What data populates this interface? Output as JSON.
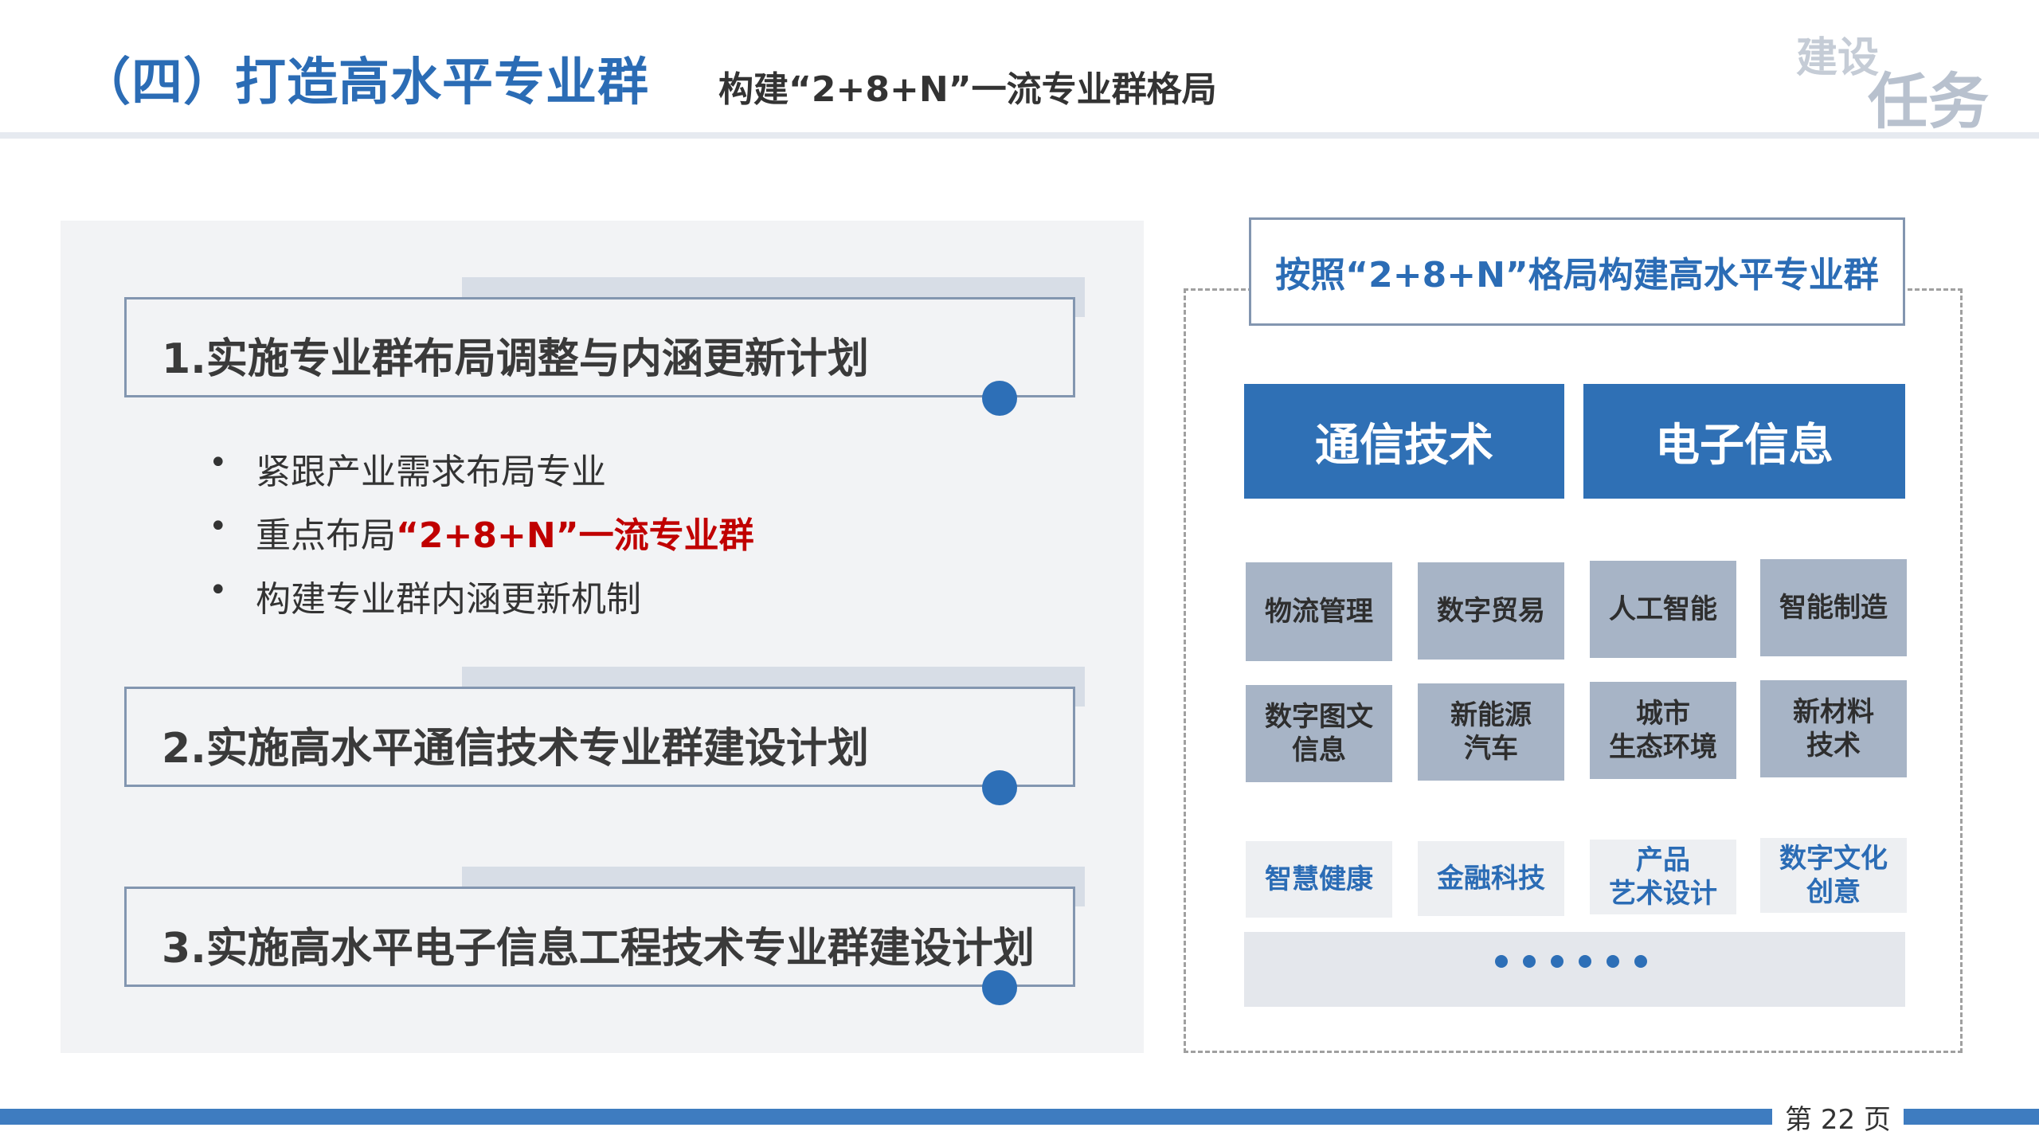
{
  "header": {
    "title": "（四）打造高水平专业群",
    "subtitle": "构建“2+8+N”一流专业群格局",
    "corner_word_1": "建设",
    "corner_word_2": "任务"
  },
  "plans": [
    {
      "label": "1.实施专业群布局调整与内涵更新计划"
    },
    {
      "label": "2.实施高水平通信技术专业群建设计划"
    },
    {
      "label": "3.实施高水平电子信息工程技术专业群建设计划"
    }
  ],
  "bullets": [
    {
      "text": "紧跟产业需求布局专业",
      "strong": ""
    },
    {
      "text": "重点布局",
      "strong": "“2+8+N”一流专业群"
    },
    {
      "text": "构建专业群内涵更新机制",
      "strong": ""
    }
  ],
  "bullet_symbol": "•",
  "diagram": {
    "header": "按照“2+8+N”格局构建高水平专业群",
    "main_groups": [
      "通信技术",
      "电子信息"
    ],
    "professional_groups": [
      {
        "line1": "物流管理",
        "line2": ""
      },
      {
        "line1": "数字贸易",
        "line2": ""
      },
      {
        "line1": "人工智能",
        "line2": ""
      },
      {
        "line1": "智能制造",
        "line2": ""
      },
      {
        "line1": "数字图文",
        "line2": "信息"
      },
      {
        "line1": "新能源",
        "line2": "汽车"
      },
      {
        "line1": "城市",
        "line2": "生态环境"
      },
      {
        "line1": "新材料",
        "line2": "技术"
      }
    ],
    "n_groups": [
      {
        "line1": "智慧健康",
        "line2": ""
      },
      {
        "line1": "金融科技",
        "line2": ""
      },
      {
        "line1": "产品",
        "line2": "艺术设计"
      },
      {
        "line1": "数字文化",
        "line2": "创意"
      }
    ]
  },
  "footer": {
    "page_label": "第 22 页"
  },
  "colors": {
    "accent_blue": "#2f70b5",
    "highlight_red": "#c00000",
    "grey_box": "#a7b4c6",
    "light_box": "#edeff2"
  }
}
